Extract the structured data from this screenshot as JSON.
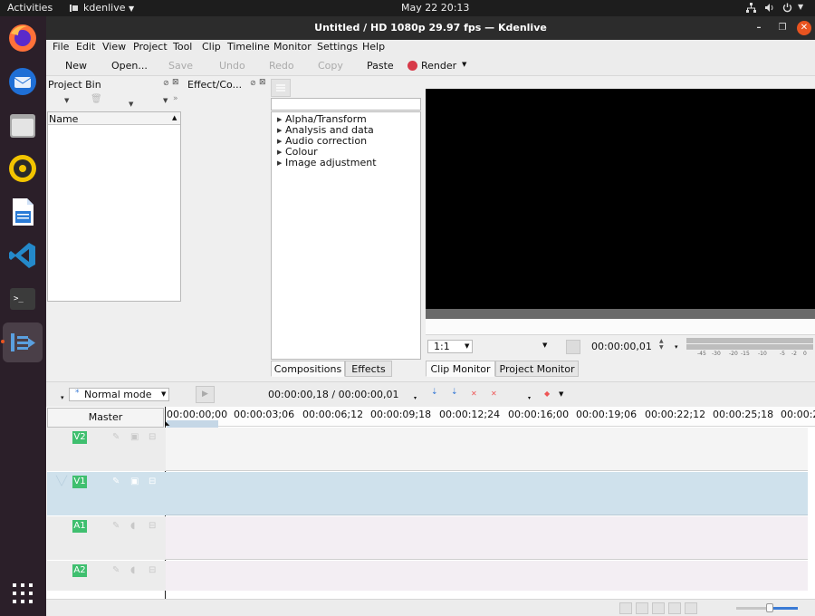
{
  "topbar": {
    "activities": "Activities",
    "app_menu": "kdenlive",
    "clock": "May 22  20:13"
  },
  "dock": {
    "apps": [
      "firefox-icon",
      "thunderbird-icon",
      "files-icon",
      "rhythmbox-icon",
      "writer-icon",
      "vscode-icon",
      "terminal-icon",
      "kdenlive-icon"
    ],
    "grid": "show-applications-icon"
  },
  "window": {
    "title": "Untitled / HD 1080p 29.97 fps — Kdenlive"
  },
  "menubar": [
    "File",
    "Edit",
    "View",
    "Project",
    "Tool",
    "Clip",
    "Timeline",
    "Monitor",
    "Settings",
    "Help"
  ],
  "toolbar": {
    "new": "New",
    "open": "Open...",
    "save": "Save",
    "undo": "Undo",
    "redo": "Redo",
    "copy": "Copy",
    "paste": "Paste",
    "render": "Render",
    "render_color": "#d73a49"
  },
  "project_bin": {
    "title": "Project Bin",
    "column_name": "Name"
  },
  "effects_panel": {
    "title": "Effect/Co...",
    "categories": [
      "Alpha/Transform",
      "Analysis and data",
      "Audio correction",
      "Colour",
      "Image adjustment"
    ],
    "tabs": [
      "Compositions",
      "Effects"
    ],
    "active_tab": "Compositions"
  },
  "monitor": {
    "zoom": "1:1",
    "timecode": "00:00:00,01",
    "tabs": [
      "Clip Monitor",
      "Project Monitor"
    ],
    "active_tab": "Clip Monitor",
    "meter_scale": [
      "-45",
      "-30",
      "-20",
      "-15",
      "-10",
      "-5",
      "-2",
      "0"
    ]
  },
  "timeline_toolbar": {
    "mode": "Normal mode",
    "position": "00:00:00,18 / 00:00:00,01"
  },
  "timeline": {
    "master_label": "Master",
    "ruler": [
      "00:00:00;00",
      "00:00:03;06",
      "00:00:06;12",
      "00:00:09;18",
      "00:00:12;24",
      "00:00:16;00",
      "00:00:19;06",
      "00:00:22;12",
      "00:00:25;18",
      "00:00:2"
    ],
    "tracks": [
      {
        "name": "V2",
        "type": "video"
      },
      {
        "name": "V1",
        "type": "video"
      },
      {
        "name": "A1",
        "type": "audio"
      },
      {
        "name": "A2",
        "type": "audio"
      }
    ],
    "colors": {
      "video_track": "#f4f4f4",
      "selected_track": "#cfe1ec",
      "audio_track": "#f3eef3",
      "badge": "#3fbf6f"
    }
  }
}
